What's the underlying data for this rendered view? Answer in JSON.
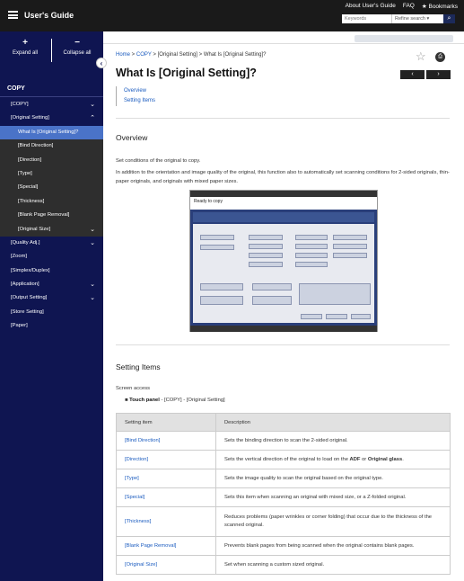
{
  "header": {
    "title": "User's Guide",
    "links": [
      "About User's Guide",
      "FAQ",
      "Bookmarks"
    ],
    "search_placeholder": "Keywords",
    "refine_label": "Refine search"
  },
  "sidebar": {
    "expand_all": "Expand all",
    "collapse_all": "Collapse all",
    "section": "COPY",
    "items": [
      {
        "label": "[COPY]",
        "level": 0,
        "chevron": "v"
      },
      {
        "label": "[Original Setting]",
        "level": 0,
        "chevron": "^"
      },
      {
        "label": "What Is [Original Setting]?",
        "level": 1,
        "selected": true
      },
      {
        "label": "[Bind Direction]",
        "level": 1
      },
      {
        "label": "[Direction]",
        "level": 1
      },
      {
        "label": "[Type]",
        "level": 1
      },
      {
        "label": "[Special]",
        "level": 1
      },
      {
        "label": "[Thickness]",
        "level": 1
      },
      {
        "label": "[Blank Page Removal]",
        "level": 1
      },
      {
        "label": "[Original Size]",
        "level": 1,
        "chevron": "v"
      },
      {
        "label": "[Quality Adj.]",
        "level": 0,
        "chevron": "v"
      },
      {
        "label": "[Zoom]",
        "level": 0
      },
      {
        "label": "[Simplex/Duplex]",
        "level": 0
      },
      {
        "label": "[Application]",
        "level": 0,
        "chevron": "v"
      },
      {
        "label": "[Output Setting]",
        "level": 0,
        "chevron": "v"
      },
      {
        "label": "[Store Setting]",
        "level": 0
      },
      {
        "label": "[Paper]",
        "level": 0
      }
    ]
  },
  "main": {
    "breadcrumb": {
      "home": "Home",
      "sep": " > ",
      "copy": "COPY",
      "orig": "[Original Setting]",
      "current": "What Is [Original Setting]?"
    },
    "title": "What Is [Original Setting]?",
    "toc": [
      "Overview",
      "Setting Items"
    ],
    "overview": {
      "heading": "Overview",
      "p1": "Set conditions of the original to copy.",
      "p2": "In addition to the orientation and image quality of the original, this function also to automatically set scanning conditions for 2-sided originals, thin-paper originals, and originals with mixed paper sizes."
    },
    "screen": {
      "status": "Ready to copy"
    },
    "setting": {
      "heading": "Setting Items",
      "access": "Screen access",
      "path_bold": "Touch panel",
      "path_rest": " - [COPY] - [Original Setting]"
    },
    "table": {
      "headers": [
        "Setting item",
        "Description"
      ],
      "rows": [
        {
          "item": "[Bind Direction]",
          "desc": "Sets the binding direction to scan the 2-sided original."
        },
        {
          "item": "[Direction]",
          "desc_pre": "Sets the vertical direction of the original to load on the ",
          "b1": "ADF",
          "mid": " or ",
          "b2": "Original glass",
          "post": "."
        },
        {
          "item": "[Type]",
          "desc": "Sets the image quality to scan the original based on the original type."
        },
        {
          "item": "[Special]",
          "desc": "Sets this item when scanning an original with mixed size, or a Z-folded original."
        },
        {
          "item": "[Thickness]",
          "desc": "Reduces problems (paper wrinkles or corner folding) that occur due to the thickness of the scanned original."
        },
        {
          "item": "[Blank Page Removal]",
          "desc": "Prevents blank pages from being scanned when the original contains blank pages."
        },
        {
          "item": "[Original Size]",
          "desc": "Set when scanning a custom sized original."
        }
      ]
    }
  }
}
